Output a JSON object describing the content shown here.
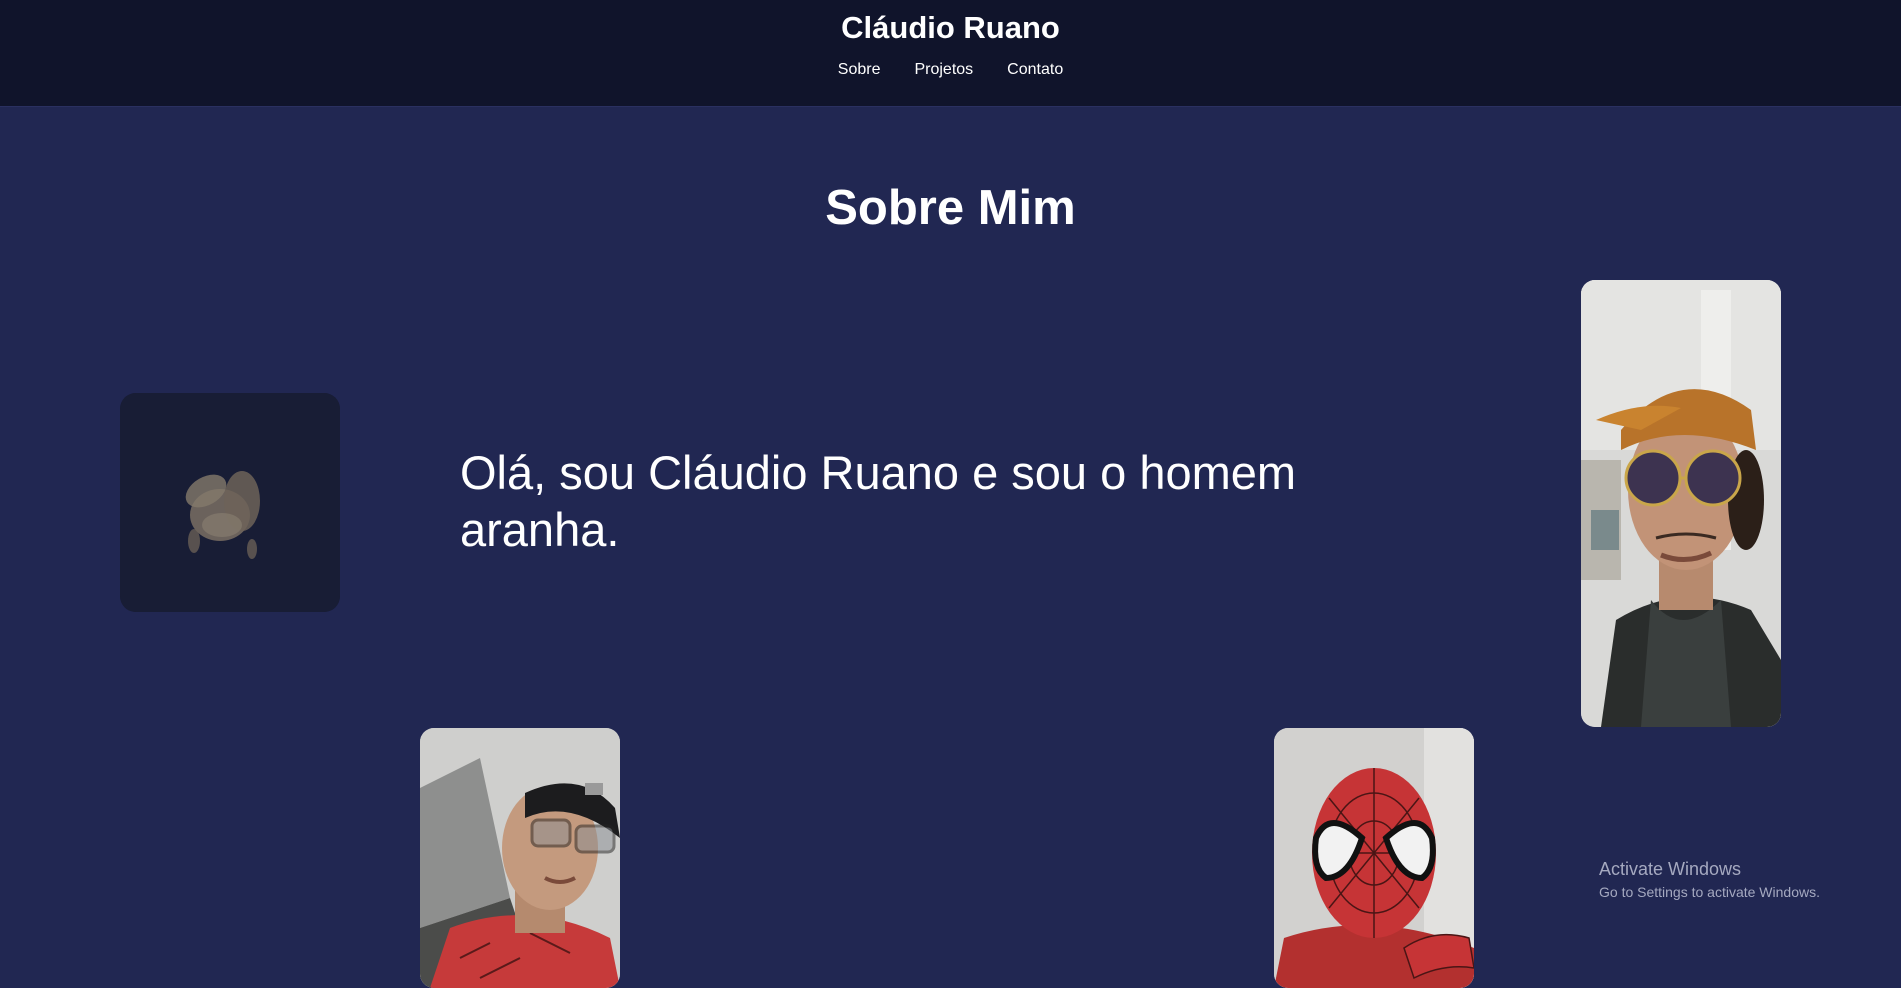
{
  "header": {
    "title": "Cláudio Ruano",
    "nav": [
      {
        "label": "Sobre"
      },
      {
        "label": "Projetos"
      },
      {
        "label": "Contato"
      }
    ]
  },
  "about": {
    "heading": "Sobre Mim",
    "intro": "Olá, sou Cláudio Ruano e sou o homem aranha."
  },
  "photos": {
    "gif": {
      "icon": "dancing-figure-gif"
    },
    "selfie_cap": {
      "icon": "selfie-cap-sunglasses-photo"
    },
    "selfie_glasses": {
      "icon": "selfie-glasses-photo"
    },
    "spiderman_mask": {
      "icon": "spiderman-mask-photo"
    }
  },
  "watermark": {
    "title": "Activate Windows",
    "subtitle": "Go to Settings to activate Windows."
  },
  "colors": {
    "background": "#212752",
    "header": "#10142b",
    "card": "#181d35",
    "text": "#ffffff"
  }
}
